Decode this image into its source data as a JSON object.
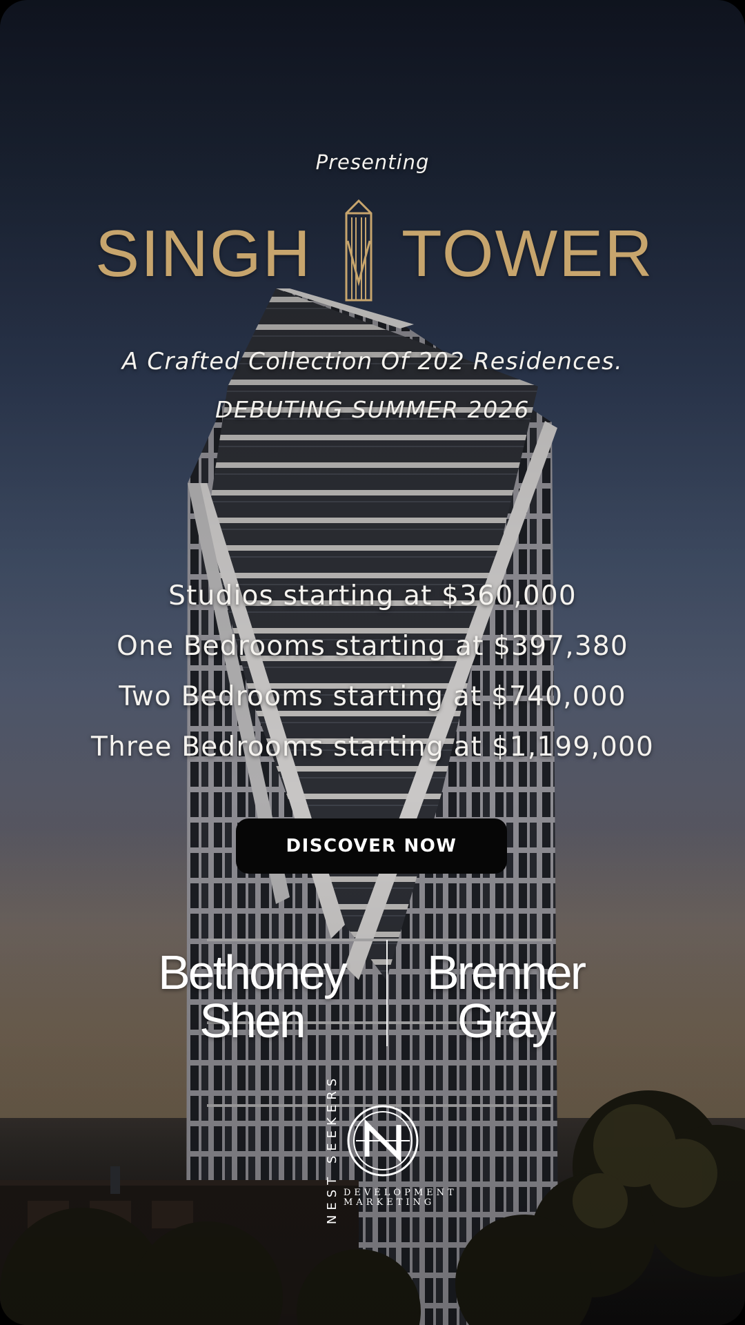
{
  "hero": {
    "presenting": "Presenting",
    "logo_left": "SINGH",
    "logo_right": "TOWER",
    "tagline": "A Crafted Collection Of 202 Residences.",
    "debut": "DEBUTING SUMMER 2026"
  },
  "pricing": [
    "Studios starting at $360,000",
    "One Bedrooms starting at $397,380",
    "Two Bedrooms starting at $740,000",
    "Three Bedrooms starting at $1,199,000"
  ],
  "cta": {
    "label": "DISCOVER NOW"
  },
  "partners": {
    "left": {
      "line1": "Bethoney",
      "line2": "Shen"
    },
    "right": {
      "line1": "Brenner",
      "line2": "Gray"
    }
  },
  "footer_logo": {
    "vertical": "NEST SEEKERS",
    "line1": "DEVELOPMENT",
    "line2": "MARKETING"
  },
  "colors": {
    "gold": "#c7a56d",
    "button_bg": "#060606",
    "text": "#f4f2ee"
  },
  "icons": {
    "logo_mark": "tower-mark-icon",
    "footer": "nest-seekers-n-logo-icon"
  }
}
